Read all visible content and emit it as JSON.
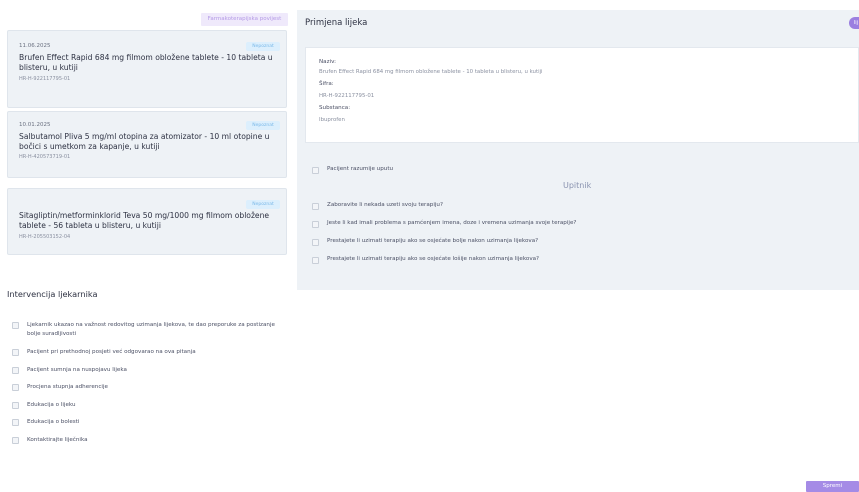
{
  "history_button": "Farmakoterapijska povijest",
  "medications": [
    {
      "date": "11.06.2025",
      "badge": "Nepoznat",
      "title": "Brufen Effect Rapid 684 mg filmom obložene tablete - 10 tableta u blisteru, u kutiji",
      "code": "HR-H-922117795-01"
    },
    {
      "date": "10.01.2025",
      "badge": "Nepoznat",
      "title": "Salbutamol Pliva 5 mg/ml otopina za atomizator - 10 ml otopine u bočici s umetkom za kapanje, u kutiji",
      "code": "HR-H-420573719-01"
    },
    {
      "date": "",
      "badge": "Nepoznat",
      "title": "Sitagliptin/metforminklorid Teva 50 mg/1000 mg filmom obložene tablete - 56 tableta u blisteru, u kutiji",
      "code": "HR-H-205503152-04"
    }
  ],
  "intervention": {
    "title": "Intervencija ljekarnika",
    "items": [
      "Ljekarnik ukazao na važnost redovitog uzimanja lijekova, te dao preporuke za postizanje bolje suradljivosti",
      "Pacijent pri prethodnoj posjeti već odgovarao na ova pitanja",
      "Pacijent sumnja na nuspojavu lijeka",
      "Procjena stupnja adherencije",
      "Edukacija o lijeku",
      "Edukacija o bolesti",
      "Kontaktirajte liječnika"
    ]
  },
  "panel": {
    "title": "Primjena lijeka",
    "avatar_text": "lij",
    "details": {
      "name_label": "Naziv:",
      "name_value": "Brufen Effect Rapid 684 mg filmom obložene tablete - 10 tableta u blisteru, u kutiji",
      "code_label": "Šifra:",
      "code_value": "HR-H-922117795-01",
      "substance_label": "Substanca:",
      "substance_value": "Ibuprofen"
    },
    "understands": "Pacijent razumije uputu",
    "questionnaire_title": "Upitnik",
    "questions": [
      "Zaboravite li nekada uzeti svoju terapiju?",
      "Jeste li kad imali problema s pamćenjem imena, doze i vremena uzimanja svoje terapije?",
      "Prestajete li uzimati terapiju ako se osjećate bolje nakon uzimanja lijekova?",
      "Prestajete li uzimati terapiju ako se osjećate lošije nakon uzimanja lijekova?"
    ]
  },
  "save_button": "Spremi"
}
